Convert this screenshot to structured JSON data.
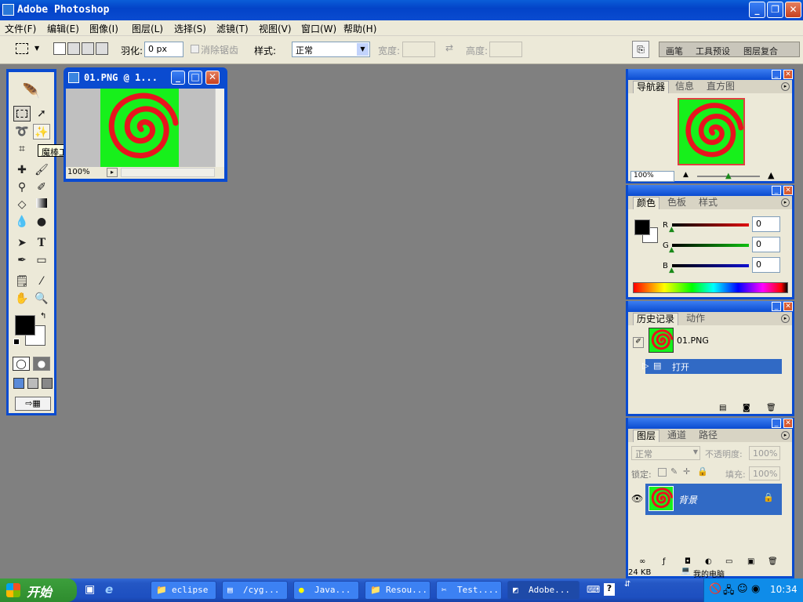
{
  "app": {
    "title": "Adobe Photoshop"
  },
  "menu": [
    "文件(F)",
    "编辑(E)",
    "图像(I)",
    "图层(L)",
    "选择(S)",
    "滤镜(T)",
    "视图(V)",
    "窗口(W)",
    "帮助(H)"
  ],
  "options": {
    "feather_label": "羽化:",
    "feather_value": "0 px",
    "antialias_label": "消除锯齿",
    "style_label": "样式:",
    "style_value": "正常",
    "width_label": "宽度:",
    "height_label": "高度:",
    "well_tabs": [
      "画笔",
      "工具预设",
      "图层复合"
    ]
  },
  "toolbox": {
    "tooltip": "魔棒工具 (W)"
  },
  "document": {
    "title": "01.PNG @ 1...",
    "zoom": "100%"
  },
  "navigator": {
    "tabs": [
      "导航器",
      "信息",
      "直方图"
    ],
    "zoom": "100%"
  },
  "color": {
    "tabs": [
      "颜色",
      "色板",
      "样式"
    ],
    "channels": [
      {
        "label": "R",
        "value": "0",
        "color": "#e01010"
      },
      {
        "label": "G",
        "value": "0",
        "color": "#10c010"
      },
      {
        "label": "B",
        "value": "0",
        "color": "#1010d0"
      }
    ]
  },
  "history": {
    "tabs": [
      "历史记录",
      "动作"
    ],
    "snapshot": "01.PNG",
    "items": [
      "打开"
    ]
  },
  "layers": {
    "tabs": [
      "图层",
      "通道",
      "路径"
    ],
    "blend_mode": "正常",
    "opacity_label": "不透明度:",
    "opacity_value": "100%",
    "lock_label": "锁定:",
    "fill_label": "填充:",
    "fill_value": "100%",
    "layer_name": "背景"
  },
  "status": {
    "size": "24 KB",
    "my_computer": "我的电脑"
  },
  "taskbar": {
    "start": "开始",
    "tasks": [
      "eclipse",
      "/cyg...",
      "Java...",
      "Resou...",
      "Test....",
      "Adobe..."
    ],
    "clock": "10:34"
  },
  "colors": {
    "accent": "#0a4bd0",
    "canvas_green": "#17f01b",
    "swirl_red": "#e8141e",
    "workspace": "#808080"
  }
}
